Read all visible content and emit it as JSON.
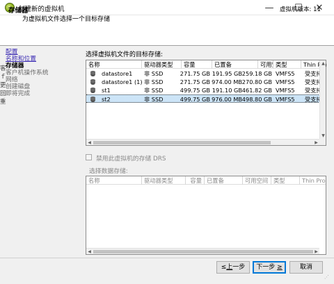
{
  "window": {
    "title": "创建新的虚拟机",
    "controls": {
      "minimize": "—",
      "maximize": "☐",
      "close": "✕"
    }
  },
  "header": {
    "title": "存储器",
    "subtitle": "为虚拟机文件选择一个目标存储",
    "version": "虚拟机版本: 11"
  },
  "left_edge_fragments": [
    "客",
    "ｆ",
    "更",
    "回",
    "重"
  ],
  "nav": {
    "items": [
      {
        "label": "配置",
        "state": "link"
      },
      {
        "label": "名称和位置",
        "state": "link"
      },
      {
        "label": "存储器",
        "state": "current"
      },
      {
        "label": "客户机操作系统",
        "state": "pending"
      },
      {
        "label": "网络",
        "state": "pending"
      },
      {
        "label": "创建磁盘",
        "state": "pending"
      },
      {
        "label": "即将完成",
        "state": "pending"
      }
    ]
  },
  "main": {
    "select_label": "选择虚拟机文件的目标存储:",
    "columns": [
      "名称",
      "驱动器类型",
      "容量",
      "已置备",
      "可用空间",
      "类型",
      "Thin Provi"
    ],
    "rows": [
      {
        "name": "datastore1",
        "drive": "非 SSD",
        "capacity": "271.75 GB",
        "provisioned": "191.95 GB",
        "free": "259.18 GB",
        "type": "VMFS5",
        "thin": "受支持",
        "selected": false
      },
      {
        "name": "datastore1 (1)",
        "drive": "非 SSD",
        "capacity": "271.75 GB",
        "provisioned": "974.00 MB",
        "free": "270.80 GB",
        "type": "VMFS5",
        "thin": "受支持",
        "selected": false
      },
      {
        "name": "st1",
        "drive": "非 SSD",
        "capacity": "499.75 GB",
        "provisioned": "191.10 GB",
        "free": "461.82 GB",
        "type": "VMFS5",
        "thin": "受支持",
        "selected": false
      },
      {
        "name": "st2",
        "drive": "非 SSD",
        "capacity": "499.75 GB",
        "provisioned": "976.00 MB",
        "free": "498.80 GB",
        "type": "VMFS5",
        "thin": "受支持",
        "selected": true
      }
    ],
    "drs_checkbox_label": "禁用此虚拟机的存储 DRS",
    "drs_checked": false,
    "select_datastore_label": "选择数据存储:",
    "columns2": [
      "名称",
      "驱动器类型",
      "容量",
      "已置备",
      "可用空间",
      "类型",
      "Thin Provi"
    ]
  },
  "buttons": {
    "back": {
      "prefix": "≤",
      "key": "上",
      "suffix": "一步"
    },
    "next": {
      "prefix": "下一步 ",
      "key": "≥",
      "suffix": ""
    },
    "cancel": "取消"
  }
}
